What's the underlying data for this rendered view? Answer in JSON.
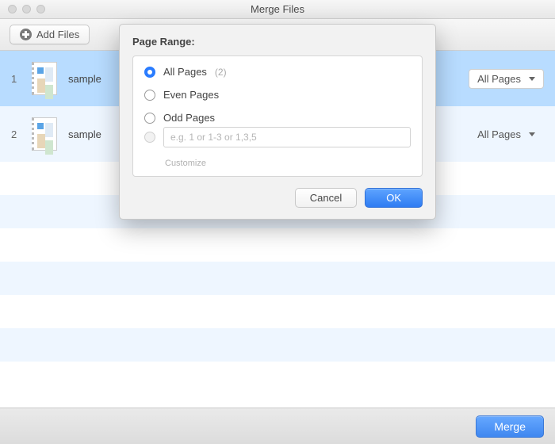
{
  "window": {
    "title": "Merge Files"
  },
  "toolbar": {
    "add_files_label": "Add Files"
  },
  "files": [
    {
      "index": "1",
      "name": "sample",
      "range": "All Pages"
    },
    {
      "index": "2",
      "name": "sample",
      "range": "All Pages"
    }
  ],
  "bottom": {
    "merge_label": "Merge"
  },
  "modal": {
    "heading": "Page Range:",
    "options": {
      "all_label": "All Pages",
      "all_count": "(2)",
      "even_label": "Even Pages",
      "odd_label": "Odd Pages",
      "custom_placeholder": "e.g. 1 or 1-3 or 1,3,5",
      "customize_label": "Customize"
    },
    "cancel_label": "Cancel",
    "ok_label": "OK",
    "selected": "all"
  }
}
